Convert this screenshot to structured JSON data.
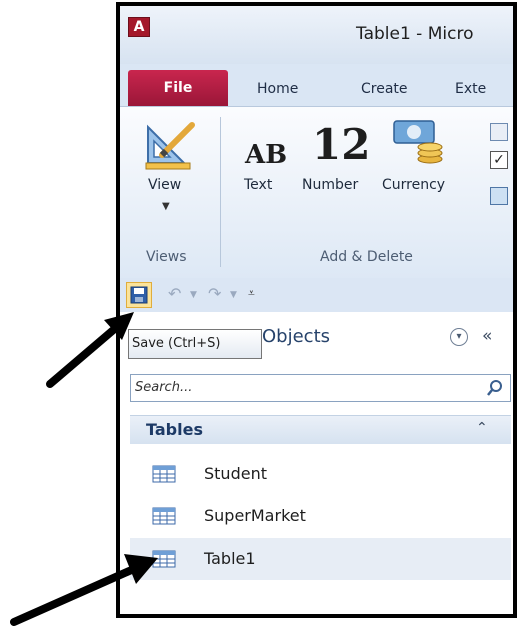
{
  "app": {
    "logo_letter": "A",
    "title": "Table1 - Micro"
  },
  "tabs": [
    {
      "label": "File"
    },
    {
      "label": "Home"
    },
    {
      "label": "Create"
    },
    {
      "label": "Exte"
    }
  ],
  "ribbon": {
    "view_label": "View",
    "text_label": "Text",
    "ab_glyph": "AB",
    "number_label": "Number",
    "number_glyph": "12",
    "currency_label": "Currency",
    "group_views": "Views",
    "group_add_delete": "Add & Delete"
  },
  "tooltip": {
    "text": "Save (Ctrl+S)"
  },
  "nav": {
    "header_suffix": "Objects",
    "search_placeholder": "Search...",
    "category": "Tables",
    "items": [
      {
        "label": "Student",
        "selected": false
      },
      {
        "label": "SuperMarket",
        "selected": false
      },
      {
        "label": "Table1",
        "selected": true
      }
    ]
  },
  "colors": {
    "file_tab": "#b21d45",
    "ribbon_bg": "#dde8f5",
    "accent": "#27436b"
  }
}
